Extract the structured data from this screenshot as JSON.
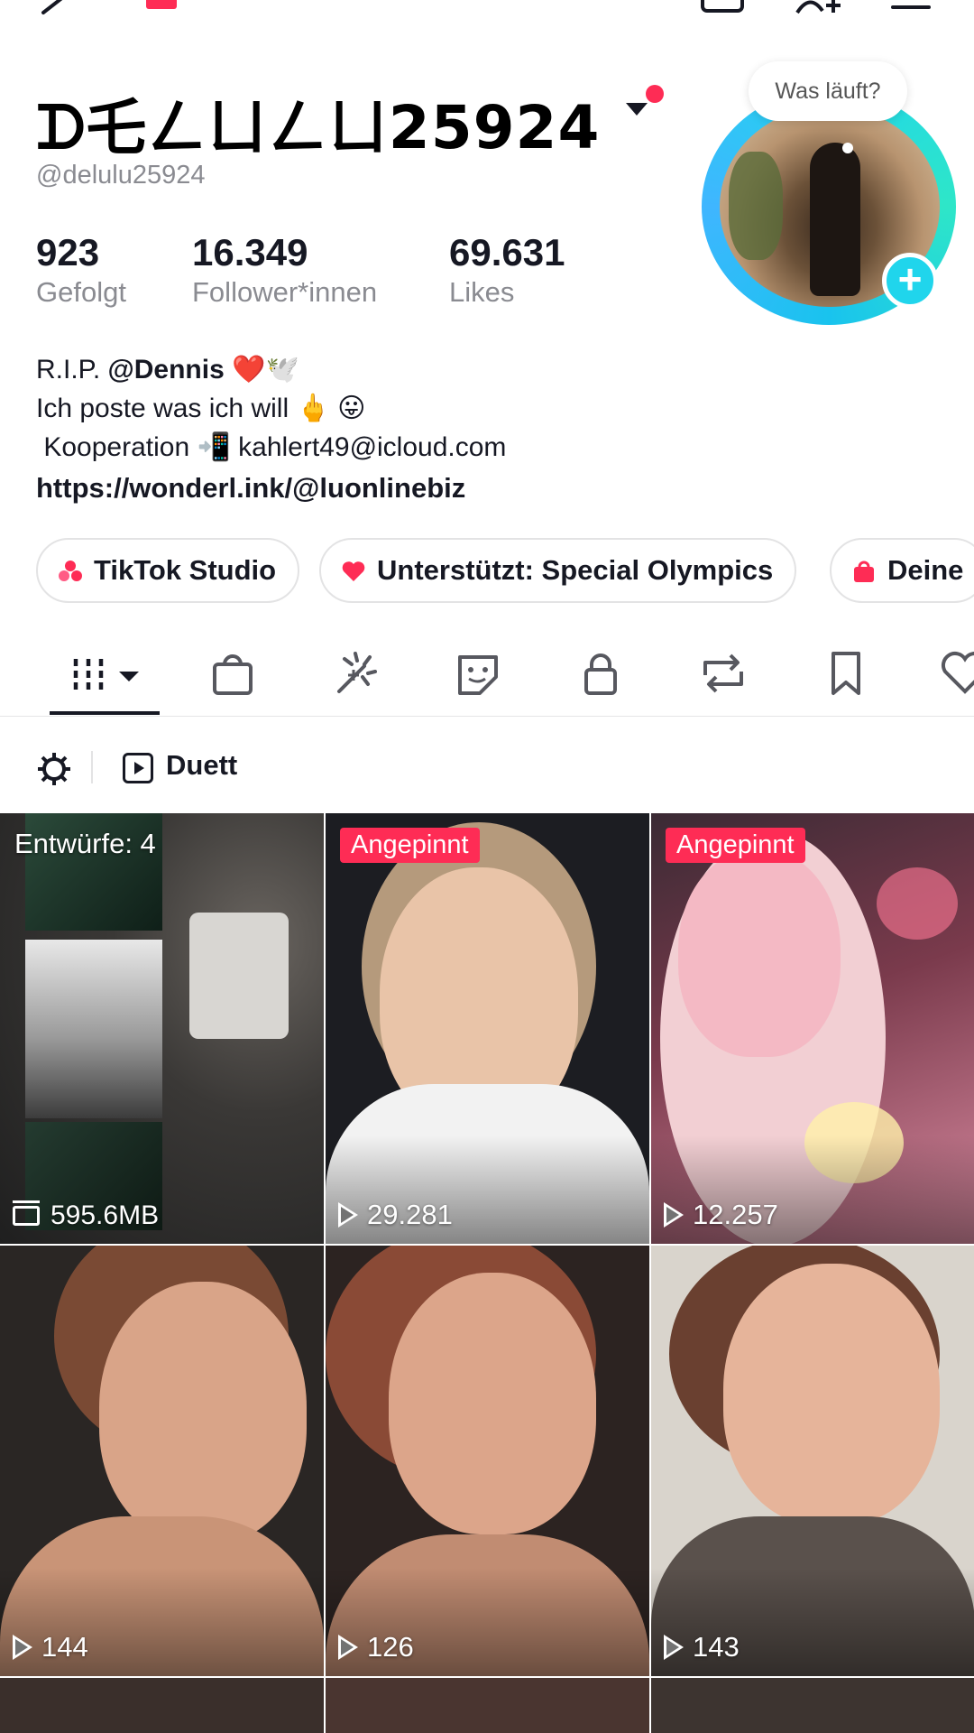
{
  "profile": {
    "display_name": "ᗪ乇ㄥㄩㄥㄩ25924",
    "handle": "@delulu25924",
    "status_bubble": "Was läuft?",
    "accent_color": "#fe2c55",
    "ring_color": "#20d5ec"
  },
  "stats": [
    {
      "value": "923",
      "label": "Gefolgt"
    },
    {
      "value": "16.349",
      "label": "Follower*innen"
    },
    {
      "value": "69.631",
      "label": "Likes"
    }
  ],
  "bio": {
    "line1_prefix": "R.I.P. ",
    "line1_mention": "@Dennis",
    "line1_emoji": "❤️🕊️",
    "line2": "Ich poste was ich will 🖕 😛",
    "line3": " Kooperation 📲 kahlert49@icloud.com",
    "link": "https://wonderl.ink/@luonlinebiz"
  },
  "pills": [
    {
      "label": "TikTok Studio",
      "icon": "studio-icon"
    },
    {
      "label": "Unterstützt: Special Olympics",
      "icon": "heart-icon"
    },
    {
      "label": "Deine",
      "icon": "shop-bag-icon"
    }
  ],
  "tabs": [
    {
      "name": "videos",
      "icon": "grid-videos-icon",
      "active": true
    },
    {
      "name": "shop",
      "icon": "shopping-bag-icon"
    },
    {
      "name": "effects",
      "icon": "sparkle-effects-icon"
    },
    {
      "name": "stickers",
      "icon": "sticker-icon"
    },
    {
      "name": "private",
      "icon": "lock-icon"
    },
    {
      "name": "reposts",
      "icon": "repost-icon"
    },
    {
      "name": "favorites",
      "icon": "bookmark-icon"
    },
    {
      "name": "liked",
      "icon": "heart-outline-icon"
    }
  ],
  "filter": {
    "duett_label": "Duett"
  },
  "grid": {
    "draft": {
      "label": "Entwürfe: 4",
      "size": "595.6MB"
    },
    "videos": [
      {
        "badge": "Angepinnt",
        "views": "29.281"
      },
      {
        "badge": "Angepinnt",
        "views": "12.257"
      },
      {
        "badge": "",
        "views": "144"
      },
      {
        "badge": "",
        "views": "126"
      },
      {
        "badge": "",
        "views": "143"
      }
    ]
  }
}
